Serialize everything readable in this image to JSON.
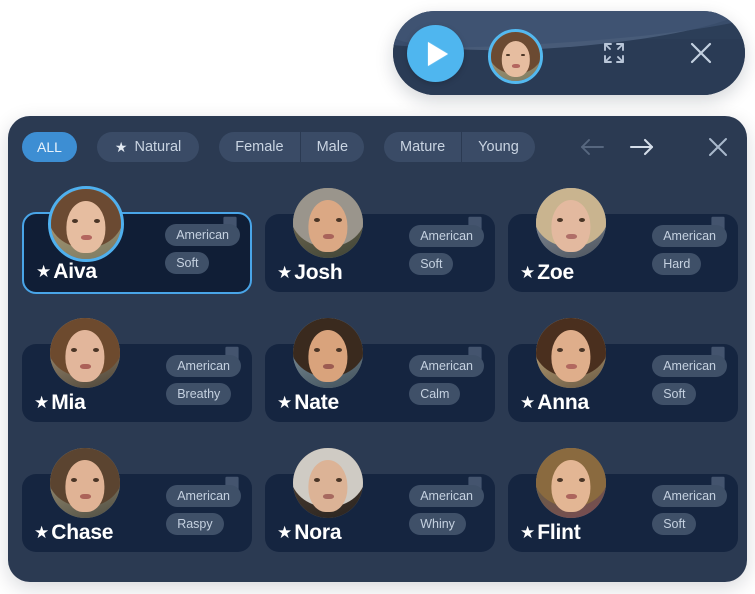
{
  "player": {
    "play_label": "play-button",
    "avatar_name": "Aiva",
    "expand_label": "expand",
    "close_label": "close"
  },
  "panel": {
    "filters": {
      "all": {
        "label": "ALL",
        "active": true
      },
      "natural": {
        "label": "Natural",
        "icon": "star-icon"
      },
      "gender": {
        "options": [
          "Female",
          "Male"
        ]
      },
      "age": {
        "options": [
          "Mature",
          "Young"
        ]
      }
    },
    "nav": {
      "prev": "←",
      "next": "→",
      "close": "×"
    }
  },
  "colors": {
    "accent": "#4fb6ef",
    "chip_active": "#3d8ed3",
    "panel_bg": "#2b3a52",
    "card_bg": "#152540",
    "card_selected_border": "#49a5e8",
    "tag_bg": "#3f5068"
  },
  "voices": [
    {
      "name": "Aiva",
      "accent": "American",
      "style": "Soft",
      "selected": true,
      "bookmarked": false
    },
    {
      "name": "Josh",
      "accent": "American",
      "style": "Soft",
      "selected": false,
      "bookmarked": false
    },
    {
      "name": "Zoe",
      "accent": "American",
      "style": "Hard",
      "selected": false,
      "bookmarked": false
    },
    {
      "name": "Mia",
      "accent": "American",
      "style": "Breathy",
      "selected": false,
      "bookmarked": false
    },
    {
      "name": "Nate",
      "accent": "American",
      "style": "Calm",
      "selected": false,
      "bookmarked": false
    },
    {
      "name": "Anna",
      "accent": "American",
      "style": "Soft",
      "selected": false,
      "bookmarked": false
    },
    {
      "name": "Chase",
      "accent": "American",
      "style": "Raspy",
      "selected": false,
      "bookmarked": false
    },
    {
      "name": "Nora",
      "accent": "American",
      "style": "Whiny",
      "selected": false,
      "bookmarked": false
    },
    {
      "name": "Flint",
      "accent": "American",
      "style": "Soft",
      "selected": false,
      "bookmarked": false
    }
  ]
}
